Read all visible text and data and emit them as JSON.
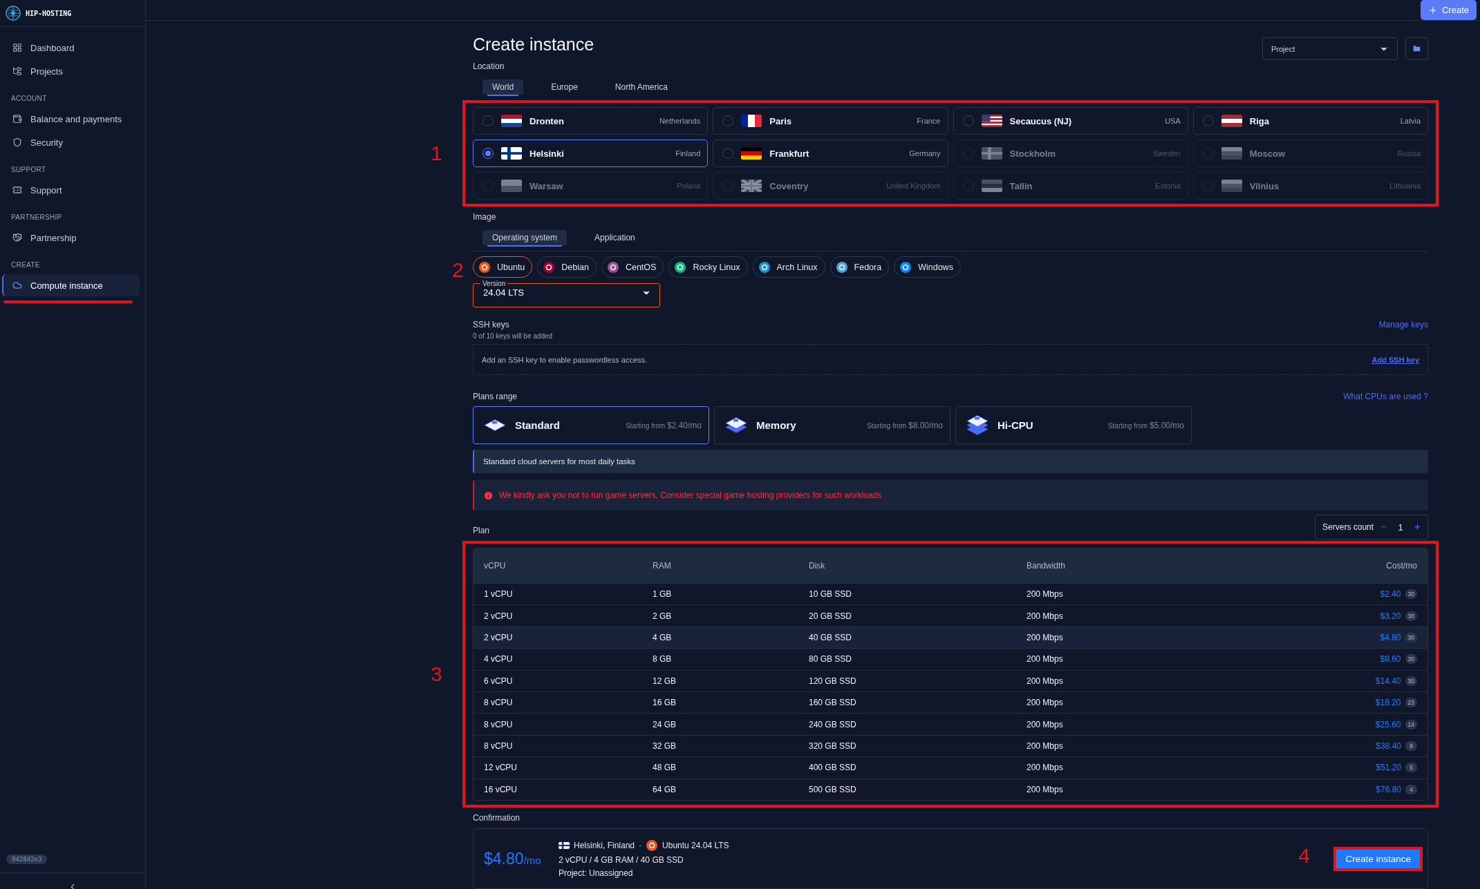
{
  "brand": {
    "name": "HIP-HOSTING"
  },
  "sidebar": {
    "groups": [
      {
        "items": [
          {
            "kind": "dashboard",
            "label": "Dashboard",
            "selected": false,
            "underlined": false
          },
          {
            "kind": "projects",
            "label": "Projects",
            "selected": false,
            "underlined": false
          }
        ]
      },
      {
        "heading": "ACCOUNT",
        "items": [
          {
            "kind": "balance",
            "label": "Balance and payments",
            "selected": false,
            "underlined": false
          },
          {
            "kind": "security",
            "label": "Security",
            "selected": false,
            "underlined": false
          }
        ]
      },
      {
        "heading": "SUPPORT",
        "items": [
          {
            "kind": "support",
            "label": "Support",
            "selected": false,
            "underlined": false
          }
        ]
      },
      {
        "heading": "PARTNERSHIP",
        "items": [
          {
            "kind": "partnership",
            "label": "Partnership",
            "selected": false,
            "underlined": false
          }
        ]
      },
      {
        "heading": "CREATE",
        "items": [
          {
            "kind": "compute",
            "label": "Compute instance",
            "selected": true,
            "underlined": true
          }
        ]
      }
    ],
    "version": "942842e3"
  },
  "topbar": {
    "create_button": "Create"
  },
  "title": "Create instance",
  "project_select": {
    "value": "Project"
  },
  "location": {
    "label": "Location",
    "annotation": "1",
    "tabs": [
      {
        "label": "World",
        "selected": true
      },
      {
        "label": "Europe",
        "selected": false
      },
      {
        "label": "North America",
        "selected": false
      }
    ],
    "cities": [
      {
        "name": "Dronten",
        "country": "Netherlands",
        "flag": {
          "kind": "stripes",
          "stripes": [
            {
              "color": "#ae1c28"
            },
            {
              "color": "#ffffff"
            },
            {
              "color": "#21468b"
            }
          ]
        },
        "selected": false,
        "disabled": false
      },
      {
        "name": "Paris",
        "country": "France",
        "flag": {
          "kind": "vstripes",
          "stripes": [
            {
              "color": "#002395"
            },
            {
              "color": "#ffffff"
            },
            {
              "color": "#ed2939"
            }
          ]
        },
        "selected": false,
        "disabled": false
      },
      {
        "name": "Secaucus (NJ)",
        "country": "USA",
        "flag": {
          "kind": "stars",
          "stripes": [
            {
              "color": "#b22234"
            },
            {
              "color": "#ffffff"
            },
            {
              "color": "#3c3b6e"
            }
          ]
        },
        "selected": false,
        "disabled": false
      },
      {
        "name": "Riga",
        "country": "Latvia",
        "flag": {
          "kind": "stripes",
          "stripes": [
            {
              "color": "#9e3039"
            },
            {
              "color": "#ffffff"
            },
            {
              "color": "#9e3039"
            }
          ]
        },
        "selected": false,
        "disabled": false
      },
      {
        "name": "Helsinki",
        "country": "Finland",
        "flag": {
          "kind": "cross",
          "stripes": [
            {
              "color": "#ffffff"
            },
            {
              "color": "#003580"
            }
          ]
        },
        "selected": true,
        "disabled": false
      },
      {
        "name": "Frankfurt",
        "country": "Germany",
        "flag": {
          "kind": "stripes",
          "stripes": [
            {
              "color": "#000000"
            },
            {
              "color": "#dd0000"
            },
            {
              "color": "#ffce00"
            }
          ]
        },
        "selected": false,
        "disabled": false
      },
      {
        "name": "Stockholm",
        "country": "Sweden",
        "flag": {
          "kind": "cross",
          "stripes": [
            {
              "color": "#4b5263"
            },
            {
              "color": "#7c8494"
            }
          ]
        },
        "selected": false,
        "disabled": true
      },
      {
        "name": "Moscow",
        "country": "Russia",
        "flag": {
          "kind": "stripes",
          "stripes": [
            {
              "color": "#7c8494"
            },
            {
              "color": "#4b5263"
            },
            {
              "color": "#3b4252"
            }
          ]
        },
        "selected": false,
        "disabled": true
      },
      {
        "name": "Warsaw",
        "country": "Poland",
        "flag": {
          "kind": "stripes",
          "stripes": [
            {
              "color": "#7c8494"
            },
            {
              "color": "#4b5263"
            }
          ]
        },
        "selected": false,
        "disabled": true
      },
      {
        "name": "Coventry",
        "country": "United Kingdom",
        "flag": {
          "kind": "union",
          "stripes": [
            {
              "color": "#3b4252"
            },
            {
              "color": "#9ca3af"
            },
            {
              "color": "#6b7280"
            }
          ]
        },
        "selected": false,
        "disabled": true
      },
      {
        "name": "Tallin",
        "country": "Estonia",
        "flag": {
          "kind": "stripes",
          "stripes": [
            {
              "color": "#4b5263"
            },
            {
              "color": "#2a2f3a"
            },
            {
              "color": "#7c8494"
            }
          ]
        },
        "selected": false,
        "disabled": true
      },
      {
        "name": "Vilnius",
        "country": "Lithuania",
        "flag": {
          "kind": "stripes",
          "stripes": [
            {
              "color": "#7c8494"
            },
            {
              "color": "#4b5566"
            },
            {
              "color": "#3b4252"
            }
          ]
        },
        "selected": false,
        "disabled": true
      }
    ]
  },
  "image": {
    "label": "Image",
    "annotation": "2",
    "tabs": [
      {
        "label": "Operating system",
        "selected": true
      },
      {
        "label": "Application",
        "selected": false
      }
    ],
    "distros": [
      {
        "name": "Ubuntu",
        "color": "#e95420",
        "selected": true
      },
      {
        "name": "Debian",
        "color": "#a80030",
        "selected": false
      },
      {
        "name": "CentOS",
        "color": "#9c4f96",
        "selected": false
      },
      {
        "name": "Rocky Linux",
        "color": "#10b981",
        "selected": false
      },
      {
        "name": "Arch Linux",
        "color": "#1793d1",
        "selected": false
      },
      {
        "name": "Fedora",
        "color": "#51a2da",
        "selected": false
      },
      {
        "name": "Windows",
        "color": "#0a84ff",
        "selected": false
      }
    ],
    "version": {
      "label": "Version",
      "value": "24.04 LTS"
    }
  },
  "ssh": {
    "label": "SSH keys",
    "link": "Manage keys",
    "note": "0 of 10 keys will be added",
    "hint": "Add an SSH key to enable passwordless access.",
    "add_link": "Add SSH key"
  },
  "plans_range": {
    "label": "Plans range",
    "link": "What CPUs are used ?",
    "plans": [
      {
        "name": "Standard",
        "prefix": "Starting from",
        "price": "$2.40/mo",
        "selected": true
      },
      {
        "name": "Memory",
        "prefix": "Starting from",
        "price": "$8.00/mo",
        "selected": false
      },
      {
        "name": "Hi-CPU",
        "prefix": "Starting from",
        "price": "$5.00/mo",
        "selected": false
      }
    ],
    "info": "Standard cloud servers for most daily tasks",
    "warning": "We kindly ask you not to run game servers. Consider special game hosting providers for such workloads"
  },
  "plan": {
    "label": "Plan",
    "annotation": "3",
    "servers_count": {
      "label": "Servers count",
      "minus": "−",
      "value": "1",
      "plus": "+"
    },
    "columns": [
      "vCPU",
      "RAM",
      "Disk",
      "Bandwidth",
      "Cost/mo"
    ],
    "rows": [
      {
        "cells": [
          "1 vCPU",
          "1 GB",
          "10 GB SSD",
          "200 Mbps"
        ],
        "cost": "$2.40",
        "stock": "30",
        "selected": false
      },
      {
        "cells": [
          "2 vCPU",
          "2 GB",
          "20 GB SSD",
          "200 Mbps"
        ],
        "cost": "$3.20",
        "stock": "30",
        "selected": false
      },
      {
        "cells": [
          "2 vCPU",
          "4 GB",
          "40 GB SSD",
          "200 Mbps"
        ],
        "cost": "$4.80",
        "stock": "30",
        "selected": true
      },
      {
        "cells": [
          "4 vCPU",
          "8 GB",
          "80 GB SSD",
          "200 Mbps"
        ],
        "cost": "$9.60",
        "stock": "30",
        "selected": false
      },
      {
        "cells": [
          "6 vCPU",
          "12 GB",
          "120 GB SSD",
          "200 Mbps"
        ],
        "cost": "$14.40",
        "stock": "30",
        "selected": false
      },
      {
        "cells": [
          "8 vCPU",
          "16 GB",
          "160 GB SSD",
          "200 Mbps"
        ],
        "cost": "$19.20",
        "stock": "23",
        "selected": false
      },
      {
        "cells": [
          "8 vCPU",
          "24 GB",
          "240 GB SSD",
          "200 Mbps"
        ],
        "cost": "$25.60",
        "stock": "14",
        "selected": false
      },
      {
        "cells": [
          "8 vCPU",
          "32 GB",
          "320 GB SSD",
          "200 Mbps"
        ],
        "cost": "$38.40",
        "stock": "9",
        "selected": false
      },
      {
        "cells": [
          "12 vCPU",
          "48 GB",
          "400 GB SSD",
          "200 Mbps"
        ],
        "cost": "$51.20",
        "stock": "5",
        "selected": false
      },
      {
        "cells": [
          "16 vCPU",
          "64 GB",
          "500 GB SSD",
          "200 Mbps"
        ],
        "cost": "$76.80",
        "stock": "4",
        "selected": false
      }
    ]
  },
  "confirmation": {
    "label": "Confirmation",
    "annotation": "4",
    "price": "$4.80",
    "unit": "/mo",
    "flag": {
      "kind": "cross",
      "stripes": [
        {
          "color": "#ffffff"
        },
        {
          "color": "#003580"
        }
      ]
    },
    "location": "Helsinki, Finland",
    "separator": "·",
    "os_icon": {
      "color": "#e95420"
    },
    "os": "Ubuntu 24.04 LTS",
    "specs": "2 vCPU / 4 GB RAM / 40 GB SSD",
    "project": "Project: Unassigned",
    "button": "Create instance"
  }
}
